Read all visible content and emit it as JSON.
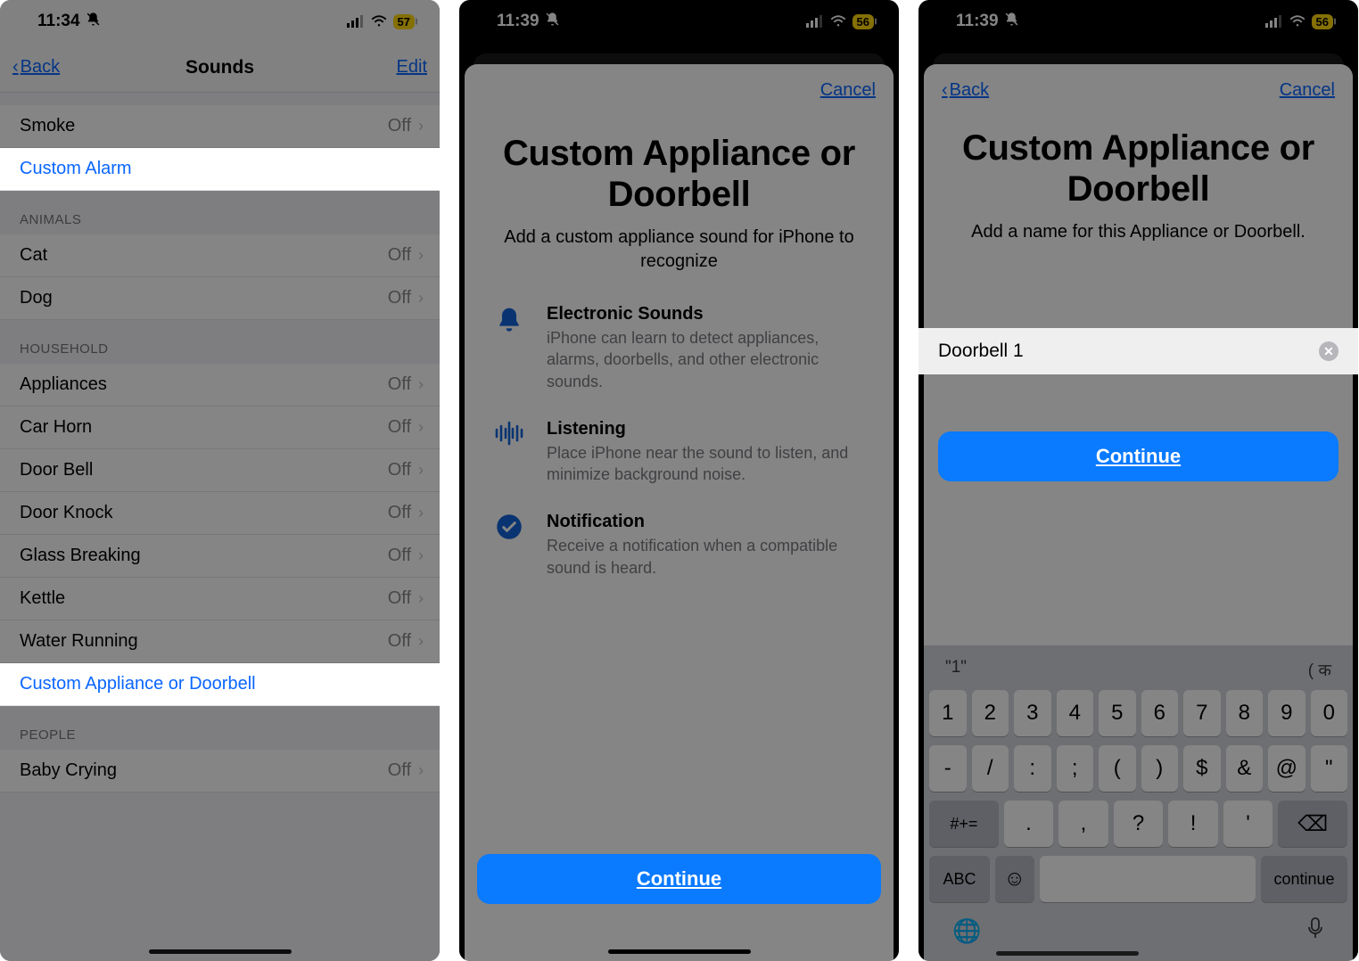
{
  "screen1": {
    "status": {
      "time": "11:34",
      "battery": "57"
    },
    "nav": {
      "back": "Back",
      "title": "Sounds",
      "edit": "Edit"
    },
    "rows_top": [
      {
        "label": "Smoke",
        "value": "Off"
      }
    ],
    "custom_alarm": "Custom Alarm",
    "section_animals": "ANIMALS",
    "animals": [
      {
        "label": "Cat",
        "value": "Off"
      },
      {
        "label": "Dog",
        "value": "Off"
      }
    ],
    "section_household": "HOUSEHOLD",
    "household": [
      {
        "label": "Appliances",
        "value": "Off"
      },
      {
        "label": "Car Horn",
        "value": "Off"
      },
      {
        "label": "Door Bell",
        "value": "Off"
      },
      {
        "label": "Door Knock",
        "value": "Off"
      },
      {
        "label": "Glass Breaking",
        "value": "Off"
      },
      {
        "label": "Kettle",
        "value": "Off"
      },
      {
        "label": "Water Running",
        "value": "Off"
      }
    ],
    "custom_appliance": "Custom Appliance or Doorbell",
    "section_people": "PEOPLE",
    "people": [
      {
        "label": "Baby Crying",
        "value": "Off"
      }
    ]
  },
  "screen2": {
    "status": {
      "time": "11:39",
      "battery": "56"
    },
    "cancel": "Cancel",
    "title": "Custom Appliance or Doorbell",
    "subtitle": "Add a custom appliance sound for iPhone to recognize",
    "features": [
      {
        "icon": "bell-icon",
        "title": "Electronic Sounds",
        "desc": "iPhone can learn to detect appliances, alarms, doorbells, and other electronic sounds."
      },
      {
        "icon": "waveform-icon",
        "title": "Listening",
        "desc": "Place iPhone near the sound to listen, and minimize background noise."
      },
      {
        "icon": "check-circle-icon",
        "title": "Notification",
        "desc": "Receive a notification when a compatible sound is heard."
      }
    ],
    "continue": "Continue"
  },
  "screen3": {
    "status": {
      "time": "11:39",
      "battery": "56"
    },
    "back": "Back",
    "cancel": "Cancel",
    "title": "Custom Appliance or Doorbell",
    "subtitle": "Add a name for this Appliance or Doorbell.",
    "name_value": "Doorbell 1",
    "continue": "Continue",
    "keyboard": {
      "suggestions": [
        "\"1\"",
        "",
        "( क"
      ],
      "row1": [
        "1",
        "2",
        "3",
        "4",
        "5",
        "6",
        "7",
        "8",
        "9",
        "0"
      ],
      "row2": [
        "-",
        "/",
        ":",
        ";",
        "(",
        ")",
        "$",
        "&",
        "@",
        "\""
      ],
      "row3_mod": "#+=",
      "row3": [
        ".",
        ",",
        "?",
        "!",
        "'"
      ],
      "row3_del": "⌫",
      "bottom_abc": "ABC",
      "bottom_continue": "continue"
    }
  }
}
